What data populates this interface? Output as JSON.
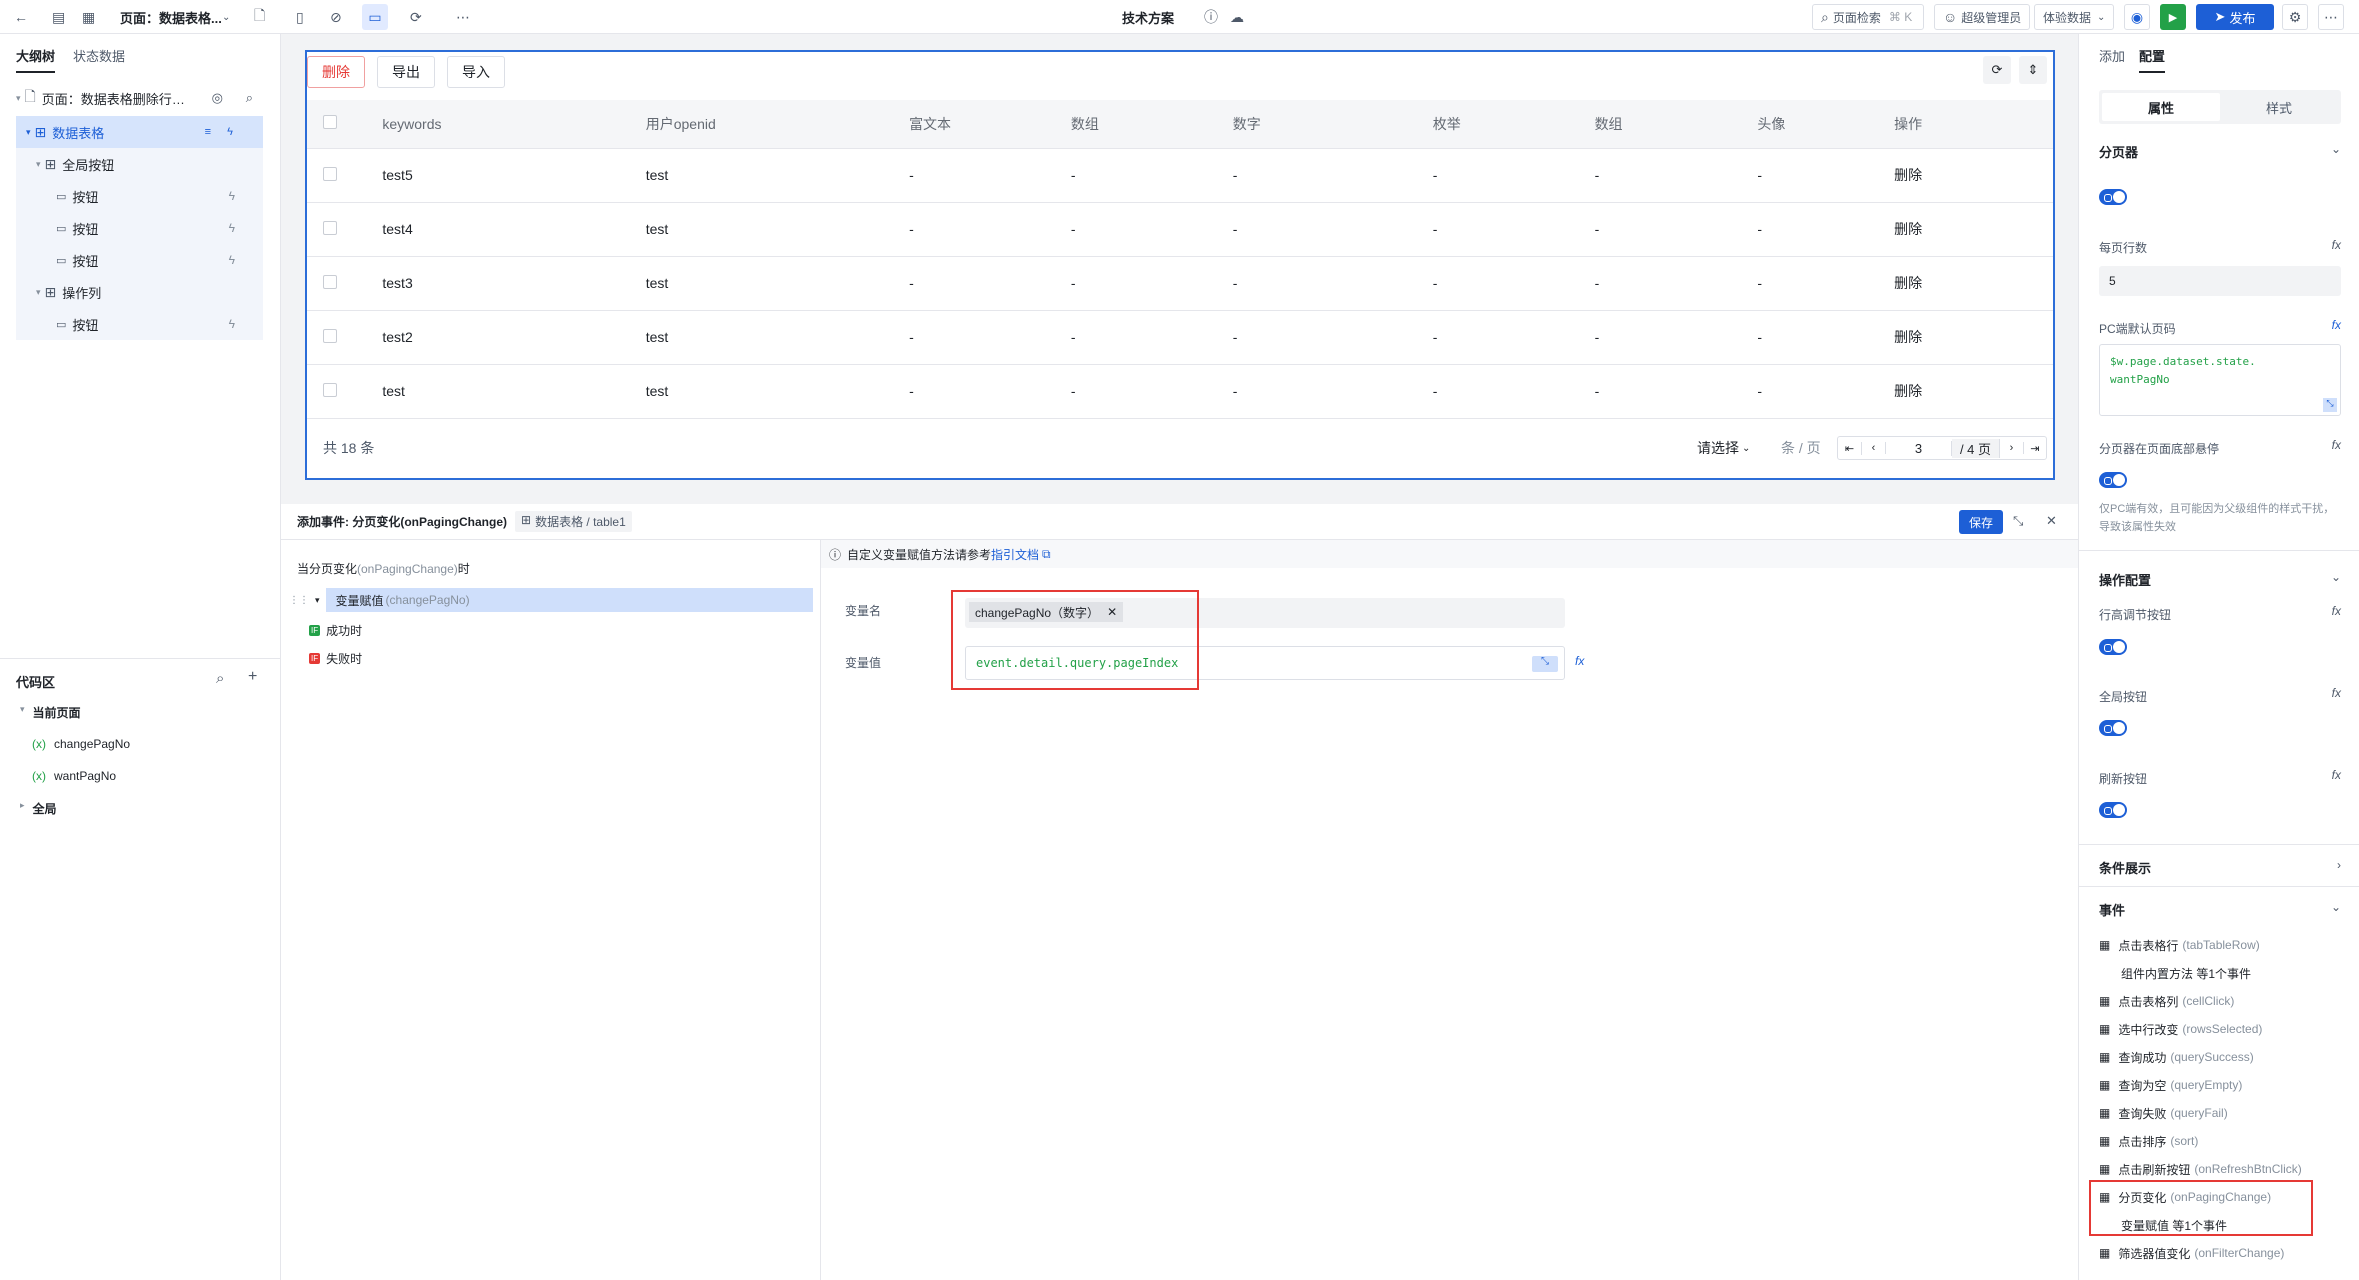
{
  "topbar": {
    "page_title": "页面：数据表格...",
    "center_title": "技术方案",
    "search_placeholder": "页面检索",
    "search_shortcut": "⌘ K",
    "user": "超级管理员",
    "data_mode": "体验数据",
    "publish": "发布"
  },
  "left": {
    "tab_outline": "大纲树",
    "tab_state": "状态数据",
    "tree": [
      {
        "label": "页面：数据表格删除行停..."
      },
      {
        "label": "数据表格"
      },
      {
        "label": "全局按钮"
      },
      {
        "label": "按钮"
      },
      {
        "label": "按钮"
      },
      {
        "label": "按钮"
      },
      {
        "label": "操作列"
      },
      {
        "label": "按钮"
      }
    ],
    "code_area": "代码区",
    "current_page": "当前页面",
    "vars": [
      "changePagNo",
      "wantPagNo"
    ],
    "global": "全局"
  },
  "canvas": {
    "buttons": [
      "删除",
      "导出",
      "导入"
    ],
    "columns": [
      "keywords",
      "用户openid",
      "富文本",
      "数组",
      "数字",
      "枚举",
      "数组",
      "头像",
      "操作"
    ],
    "rows": [
      [
        "test5",
        "test",
        "-",
        "-",
        "-",
        "-",
        "-",
        "-",
        "删除"
      ],
      [
        "test4",
        "test",
        "-",
        "-",
        "-",
        "-",
        "-",
        "-",
        "删除"
      ],
      [
        "test3",
        "test",
        "-",
        "-",
        "-",
        "-",
        "-",
        "-",
        "删除"
      ],
      [
        "test2",
        "test",
        "-",
        "-",
        "-",
        "-",
        "-",
        "-",
        "删除"
      ],
      [
        "test",
        "test",
        "-",
        "-",
        "-",
        "-",
        "-",
        "-",
        "删除"
      ]
    ],
    "total": "共  18  条",
    "page_size": "请选择",
    "per_page": "条 / 页",
    "current_page": "3",
    "total_pages": "/ 4 页"
  },
  "event": {
    "title": "添加事件: 分页变化(onPagingChange)",
    "component": "数据表格 / table1",
    "save": "保存",
    "trigger_prefix": "当分页变化",
    "trigger_event": "(onPagingChange)",
    "trigger_suffix": "时",
    "action": "变量赋值",
    "action_param": "(changePagNo)",
    "success": "成功时",
    "fail": "失败时",
    "tip": "自定义变量赋值方法请参考",
    "tip_link": "指引文档",
    "var_name_label": "变量名",
    "var_name_value": "changePagNo（数字）",
    "var_value_label": "变量值",
    "var_value": "event.detail.query.pageIndex"
  },
  "right": {
    "tab_add": "添加",
    "tab_config": "配置",
    "seg_props": "属性",
    "seg_style": "样式",
    "pager_section": "分页器",
    "rows_per_page_label": "每页行数",
    "rows_per_page": "5",
    "pc_default_label": "PC端默认页码",
    "pc_default_code": "$w.page.dataset.state.\nwantPagNo",
    "pager_float_label": "分页器在页面底部悬停",
    "pager_float_hint": "仅PC端有效，且可能因为父级组件的样式干扰，导致该属性失效",
    "ops_section": "操作配置",
    "row_height_label": "行高调节按钮",
    "global_btn_label": "全局按钮",
    "refresh_btn_label": "刷新按钮",
    "cond_section": "条件展示",
    "events_section": "事件",
    "events": [
      {
        "cn": "点击表格行",
        "en": "(tabTableRow)"
      },
      {
        "cn": "组件内置方法 等1个事件",
        "en": ""
      },
      {
        "cn": "点击表格列",
        "en": "(cellClick)"
      },
      {
        "cn": "选中行改变",
        "en": "(rowsSelected)"
      },
      {
        "cn": "查询成功",
        "en": "(querySuccess)"
      },
      {
        "cn": "查询为空",
        "en": "(queryEmpty)"
      },
      {
        "cn": "查询失败",
        "en": "(queryFail)"
      },
      {
        "cn": "点击排序",
        "en": "(sort)"
      },
      {
        "cn": "点击刷新按钮",
        "en": "(onRefreshBtnClick)"
      },
      {
        "cn": "分页变化",
        "en": "(onPagingChange)"
      },
      {
        "cn": "变量赋值 等1个事件",
        "en": ""
      },
      {
        "cn": "筛选器值变化",
        "en": "(onFilterChange)"
      }
    ]
  }
}
